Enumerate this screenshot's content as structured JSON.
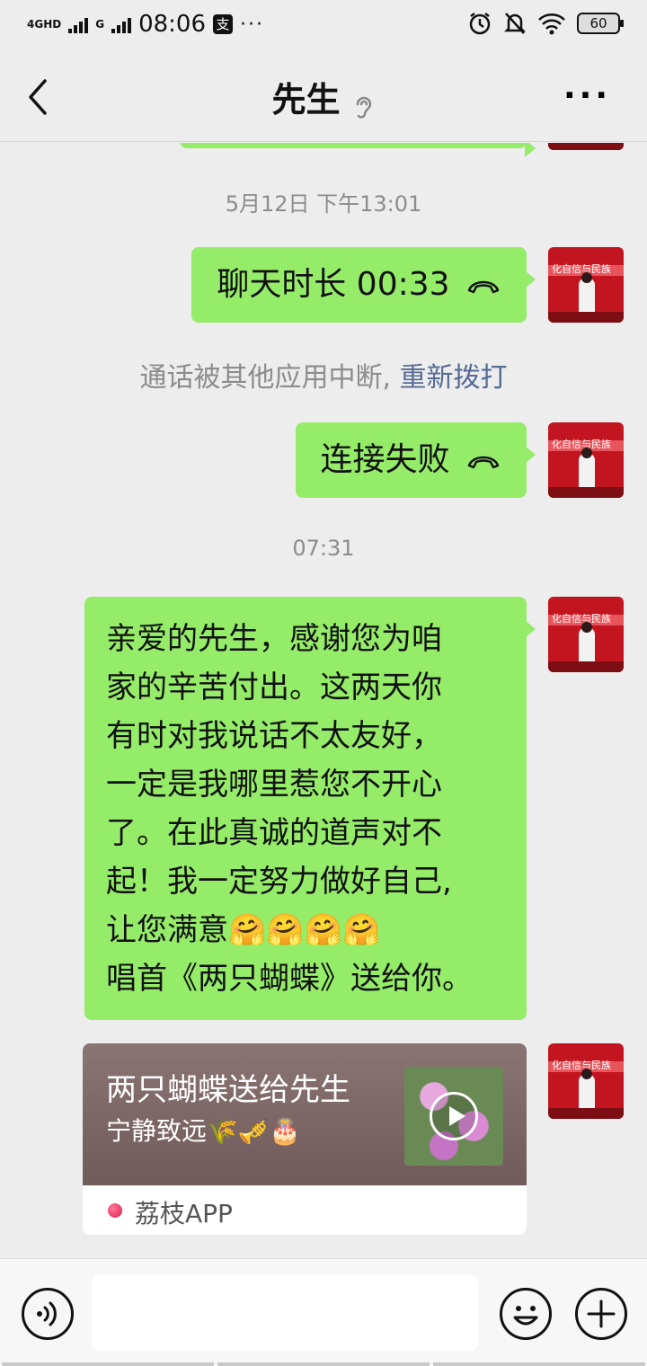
{
  "status_bar": {
    "network_left": "4GHD",
    "network_right": "G",
    "time": "08:06",
    "app_badge": "支",
    "more": "···",
    "battery": "60"
  },
  "header": {
    "title": "先生",
    "more": "···"
  },
  "chat": {
    "timestamp_1": "5月12日 下午13:01",
    "call_1": "聊天时长 00:33",
    "system_text": "通话被其他应用中断,",
    "system_link": "重新拨打",
    "call_2": "连接失败",
    "timestamp_2": "07:31",
    "long_message": [
      "亲爱的先生，感谢您为咱",
      "家的辛苦付出。这两天你",
      "有时对我说话不太友好，",
      "一定是我哪里惹您不开心",
      "了。在此真诚的道声对不",
      "起！我一定努力做好自己,",
      "让您满意🤗🤗🤗🤗",
      "唱首《两只蝴蝶》送给你。"
    ],
    "share_card": {
      "title": "两只蝴蝶送给先生",
      "subtitle": "宁静致远🌾🎺🎂",
      "app_name": "荔枝APP"
    }
  },
  "input_bar": {
    "placeholder": ""
  }
}
